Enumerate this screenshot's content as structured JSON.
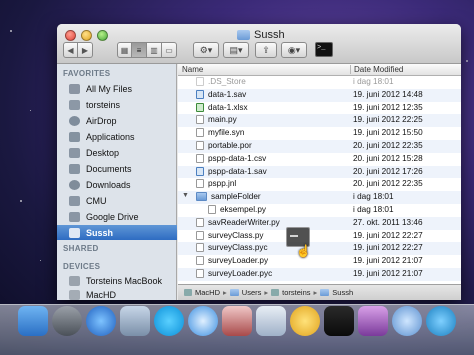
{
  "window": {
    "title": "Sussh"
  },
  "toolbar": {
    "back_label": "◀",
    "forward_label": "▶"
  },
  "sidebar": {
    "favorites_header": "FAVORITES",
    "shared_header": "SHARED",
    "devices_header": "DEVICES",
    "favorites": [
      {
        "label": "All My Files",
        "icon": "all-files-icon"
      },
      {
        "label": "torsteins",
        "icon": "home-icon"
      },
      {
        "label": "AirDrop",
        "icon": "airdrop-icon"
      },
      {
        "label": "Applications",
        "icon": "applications-icon"
      },
      {
        "label": "Desktop",
        "icon": "desktop-icon"
      },
      {
        "label": "Documents",
        "icon": "documents-icon"
      },
      {
        "label": "Downloads",
        "icon": "downloads-icon"
      },
      {
        "label": "CMU",
        "icon": "folder-icon"
      },
      {
        "label": "Google Drive",
        "icon": "folder-icon"
      },
      {
        "label": "Sussh",
        "icon": "folder-icon"
      }
    ],
    "devices": [
      {
        "label": "Torsteins MacBook",
        "icon": "laptop-icon"
      },
      {
        "label": "MacHD",
        "icon": "harddisk-icon"
      }
    ]
  },
  "list": {
    "col_name": "Name",
    "col_date": "Date Modified",
    "rows": [
      {
        "name": ".DS_Store",
        "date": "i dag 18:01"
      },
      {
        "name": "data-1.sav",
        "date": "19. juni 2012 14:48"
      },
      {
        "name": "data-1.xlsx",
        "date": "19. juni 2012 12:35"
      },
      {
        "name": "main.py",
        "date": "19. juni 2012 22:25"
      },
      {
        "name": "myfile.syn",
        "date": "19. juni 2012 15:50"
      },
      {
        "name": "portable.por",
        "date": "20. juni 2012 22:35"
      },
      {
        "name": "pspp-data-1.csv",
        "date": "20. juni 2012 15:28"
      },
      {
        "name": "pspp-data-1.sav",
        "date": "20. juni 2012 17:26"
      },
      {
        "name": "pspp.jnl",
        "date": "20. juni 2012 22:35"
      },
      {
        "name": "sampleFolder",
        "date": "i dag 18:01"
      },
      {
        "name": "eksempel.py",
        "date": "i dag 18:01"
      },
      {
        "name": "savReaderWriter.py",
        "date": "27. okt. 2011 13:46"
      },
      {
        "name": "surveyClass.py",
        "date": "19. juni 2012 22:27"
      },
      {
        "name": "surveyClass.pyc",
        "date": "19. juni 2012 22:27"
      },
      {
        "name": "surveyLoader.py",
        "date": "19. juni 2012 21:07"
      },
      {
        "name": "surveyLoader.pyc",
        "date": "19. juni 2012 21:07"
      }
    ]
  },
  "pathbar": {
    "items": [
      "MacHD",
      "Users",
      "torsteins",
      "Sussh"
    ]
  },
  "terminal_button_label": ">_"
}
